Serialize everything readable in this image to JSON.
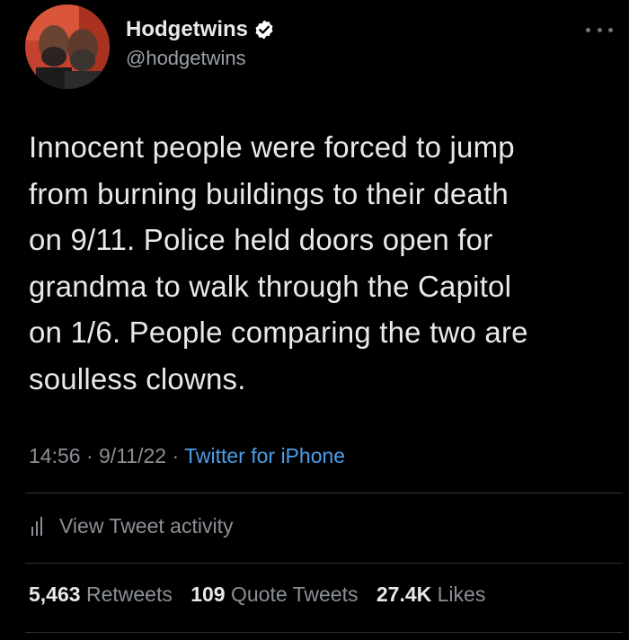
{
  "user": {
    "display_name": "Hodgetwins",
    "handle": "@hodgetwins",
    "verified": true
  },
  "icons": {
    "verified": "verified-badge-icon",
    "more": "more-options-icon",
    "activity": "bar-chart-icon"
  },
  "tweet": {
    "lines": [
      "Innocent people were forced to jump",
      "from burning buildings to their death",
      "on 9/11. Police held doors open for",
      "grandma to walk through the Capitol",
      "on 1/6. People comparing the two are",
      "soulless clowns."
    ]
  },
  "meta": {
    "time": "14:56",
    "separator": "·",
    "date": "9/11/22",
    "source": "Twitter for iPhone"
  },
  "activity": {
    "label": "View Tweet activity"
  },
  "stats": {
    "retweets_count": "5,463",
    "retweets_label": "Retweets",
    "quotes_count": "109",
    "quotes_label": "Quote Tweets",
    "likes_count": "27.4K",
    "likes_label": "Likes"
  },
  "colors": {
    "background": "#000000",
    "text_primary": "#e7e9ea",
    "text_secondary": "#8b9096",
    "link": "#4c9ee8",
    "verified": "#ffffff",
    "divider": "#2f3336"
  }
}
